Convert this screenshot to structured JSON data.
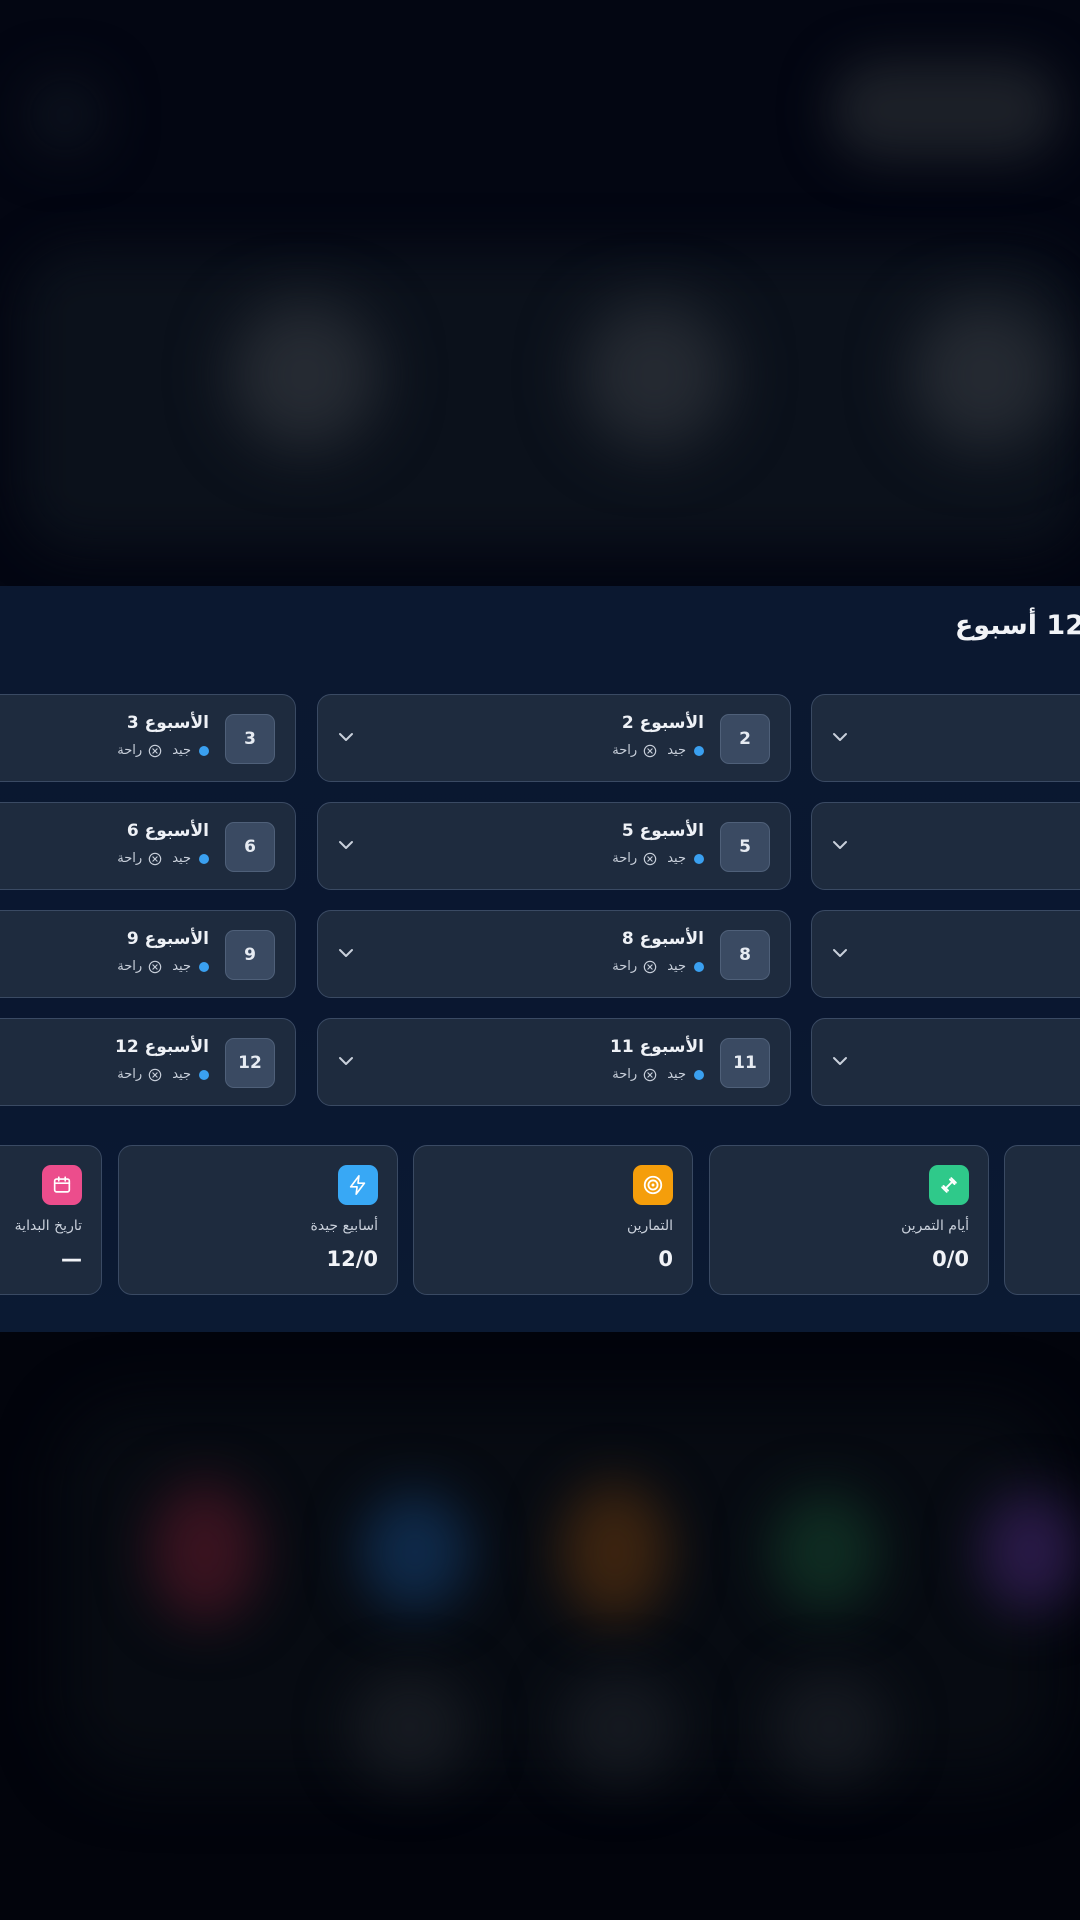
{
  "panel": {
    "title": "12 أسبوع"
  },
  "weeks": [
    {
      "number": "2",
      "title": "الأسبوع 2",
      "quality": "جيد",
      "rest": "راحة"
    },
    {
      "number": "3",
      "title": "الأسبوع 3",
      "quality": "جيد",
      "rest": "راحة"
    },
    {
      "number": "5",
      "title": "الأسبوع 5",
      "quality": "جيد",
      "rest": "راحة"
    },
    {
      "number": "6",
      "title": "الأسبوع 6",
      "quality": "جيد",
      "rest": "راحة"
    },
    {
      "number": "8",
      "title": "الأسبوع 8",
      "quality": "جيد",
      "rest": "راحة"
    },
    {
      "number": "9",
      "title": "الأسبوع 9",
      "quality": "جيد",
      "rest": "راحة"
    },
    {
      "number": "11",
      "title": "الأسبوع 11",
      "quality": "جيد",
      "rest": "راحة"
    },
    {
      "number": "12",
      "title": "الأسبوع 12",
      "quality": "جيد",
      "rest": "راحة"
    }
  ],
  "stats": [
    {
      "label": "أيام التمرين",
      "value": "0/0",
      "icon": "dumbbell-icon",
      "color": "#2fc98a"
    },
    {
      "label": "التمارين",
      "value": "0",
      "icon": "target-icon",
      "color": "#f59e0b"
    },
    {
      "label": "أسابيع جيدة",
      "value": "12/0",
      "icon": "lightning-icon",
      "color": "#38a8f5"
    },
    {
      "label": "تاريخ البداية",
      "value": "—",
      "icon": "calendar-icon",
      "color": "#ec4d8c"
    }
  ],
  "colors": {
    "panel_bg": "#0b1830",
    "card_bg": "#1e2b3e",
    "card_border": "#3a4a63",
    "good_dot": "#3aa0f0"
  }
}
